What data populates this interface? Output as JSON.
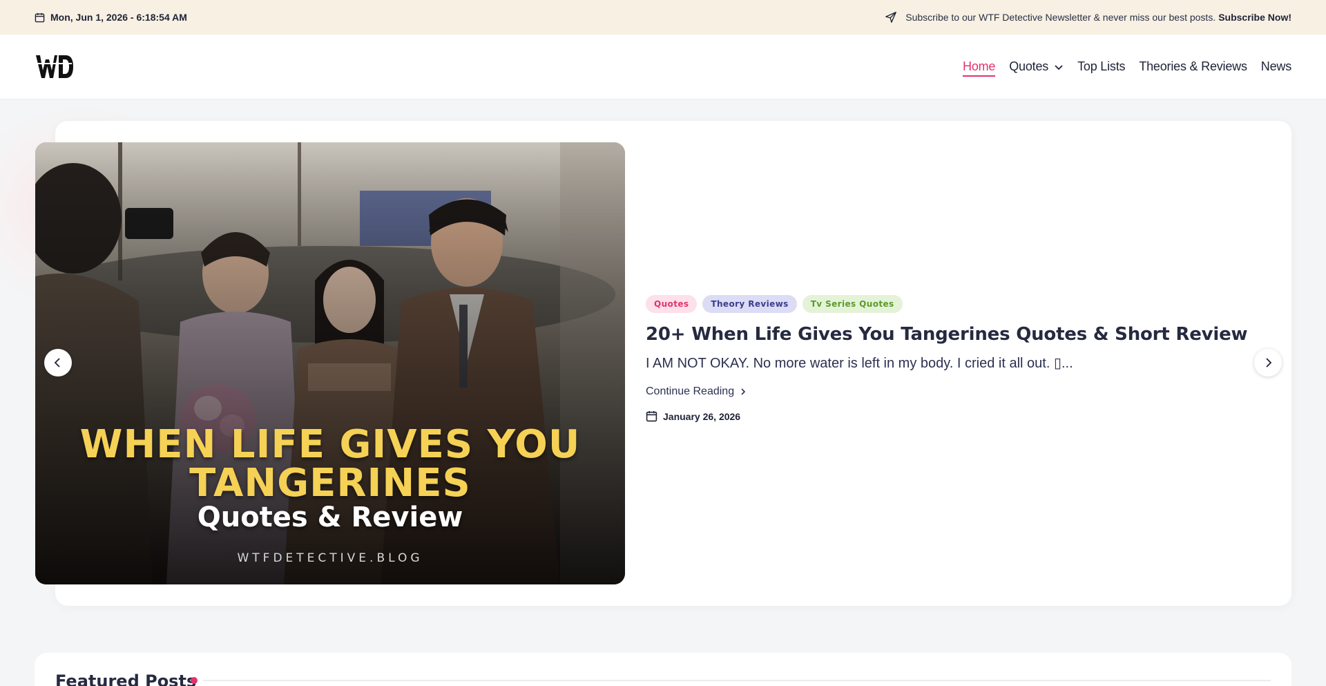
{
  "topbar": {
    "datetime": "Mon, Jun 1, 2026 - 6:18:54 AM",
    "newsletter_text": "Subscribe to our WTF Detective Newsletter & never miss our best posts.",
    "newsletter_cta": "Subscribe Now!"
  },
  "header": {
    "logo_text": "WD",
    "nav": [
      {
        "label": "Home",
        "active": true
      },
      {
        "label": "Quotes",
        "has_dropdown": true
      },
      {
        "label": "Top Lists"
      },
      {
        "label": "Theories & Reviews"
      },
      {
        "label": "News"
      }
    ]
  },
  "slider": {
    "image": {
      "title_line1": "WHEN LIFE GIVES YOU",
      "title_line2": "TANGERINES",
      "subtitle": "Quotes & Review",
      "site": "WTFDETECTIVE.BLOG"
    },
    "post": {
      "tags": [
        "Quotes",
        "Theory Reviews",
        "Tv Series Quotes"
      ],
      "title": "20+ When Life Gives You Tangerines Quotes & Short Review",
      "excerpt": "I AM NOT OKAY. No more water is left in my body. I cried it all out. ▯...",
      "continue_label": "Continue Reading",
      "date": "January 26, 2026"
    }
  },
  "featured": {
    "title": "Featured Posts"
  },
  "colors": {
    "accent": "#e2336b",
    "topbar_bg": "#f7f0e3",
    "hero_title": "#f5d155"
  }
}
